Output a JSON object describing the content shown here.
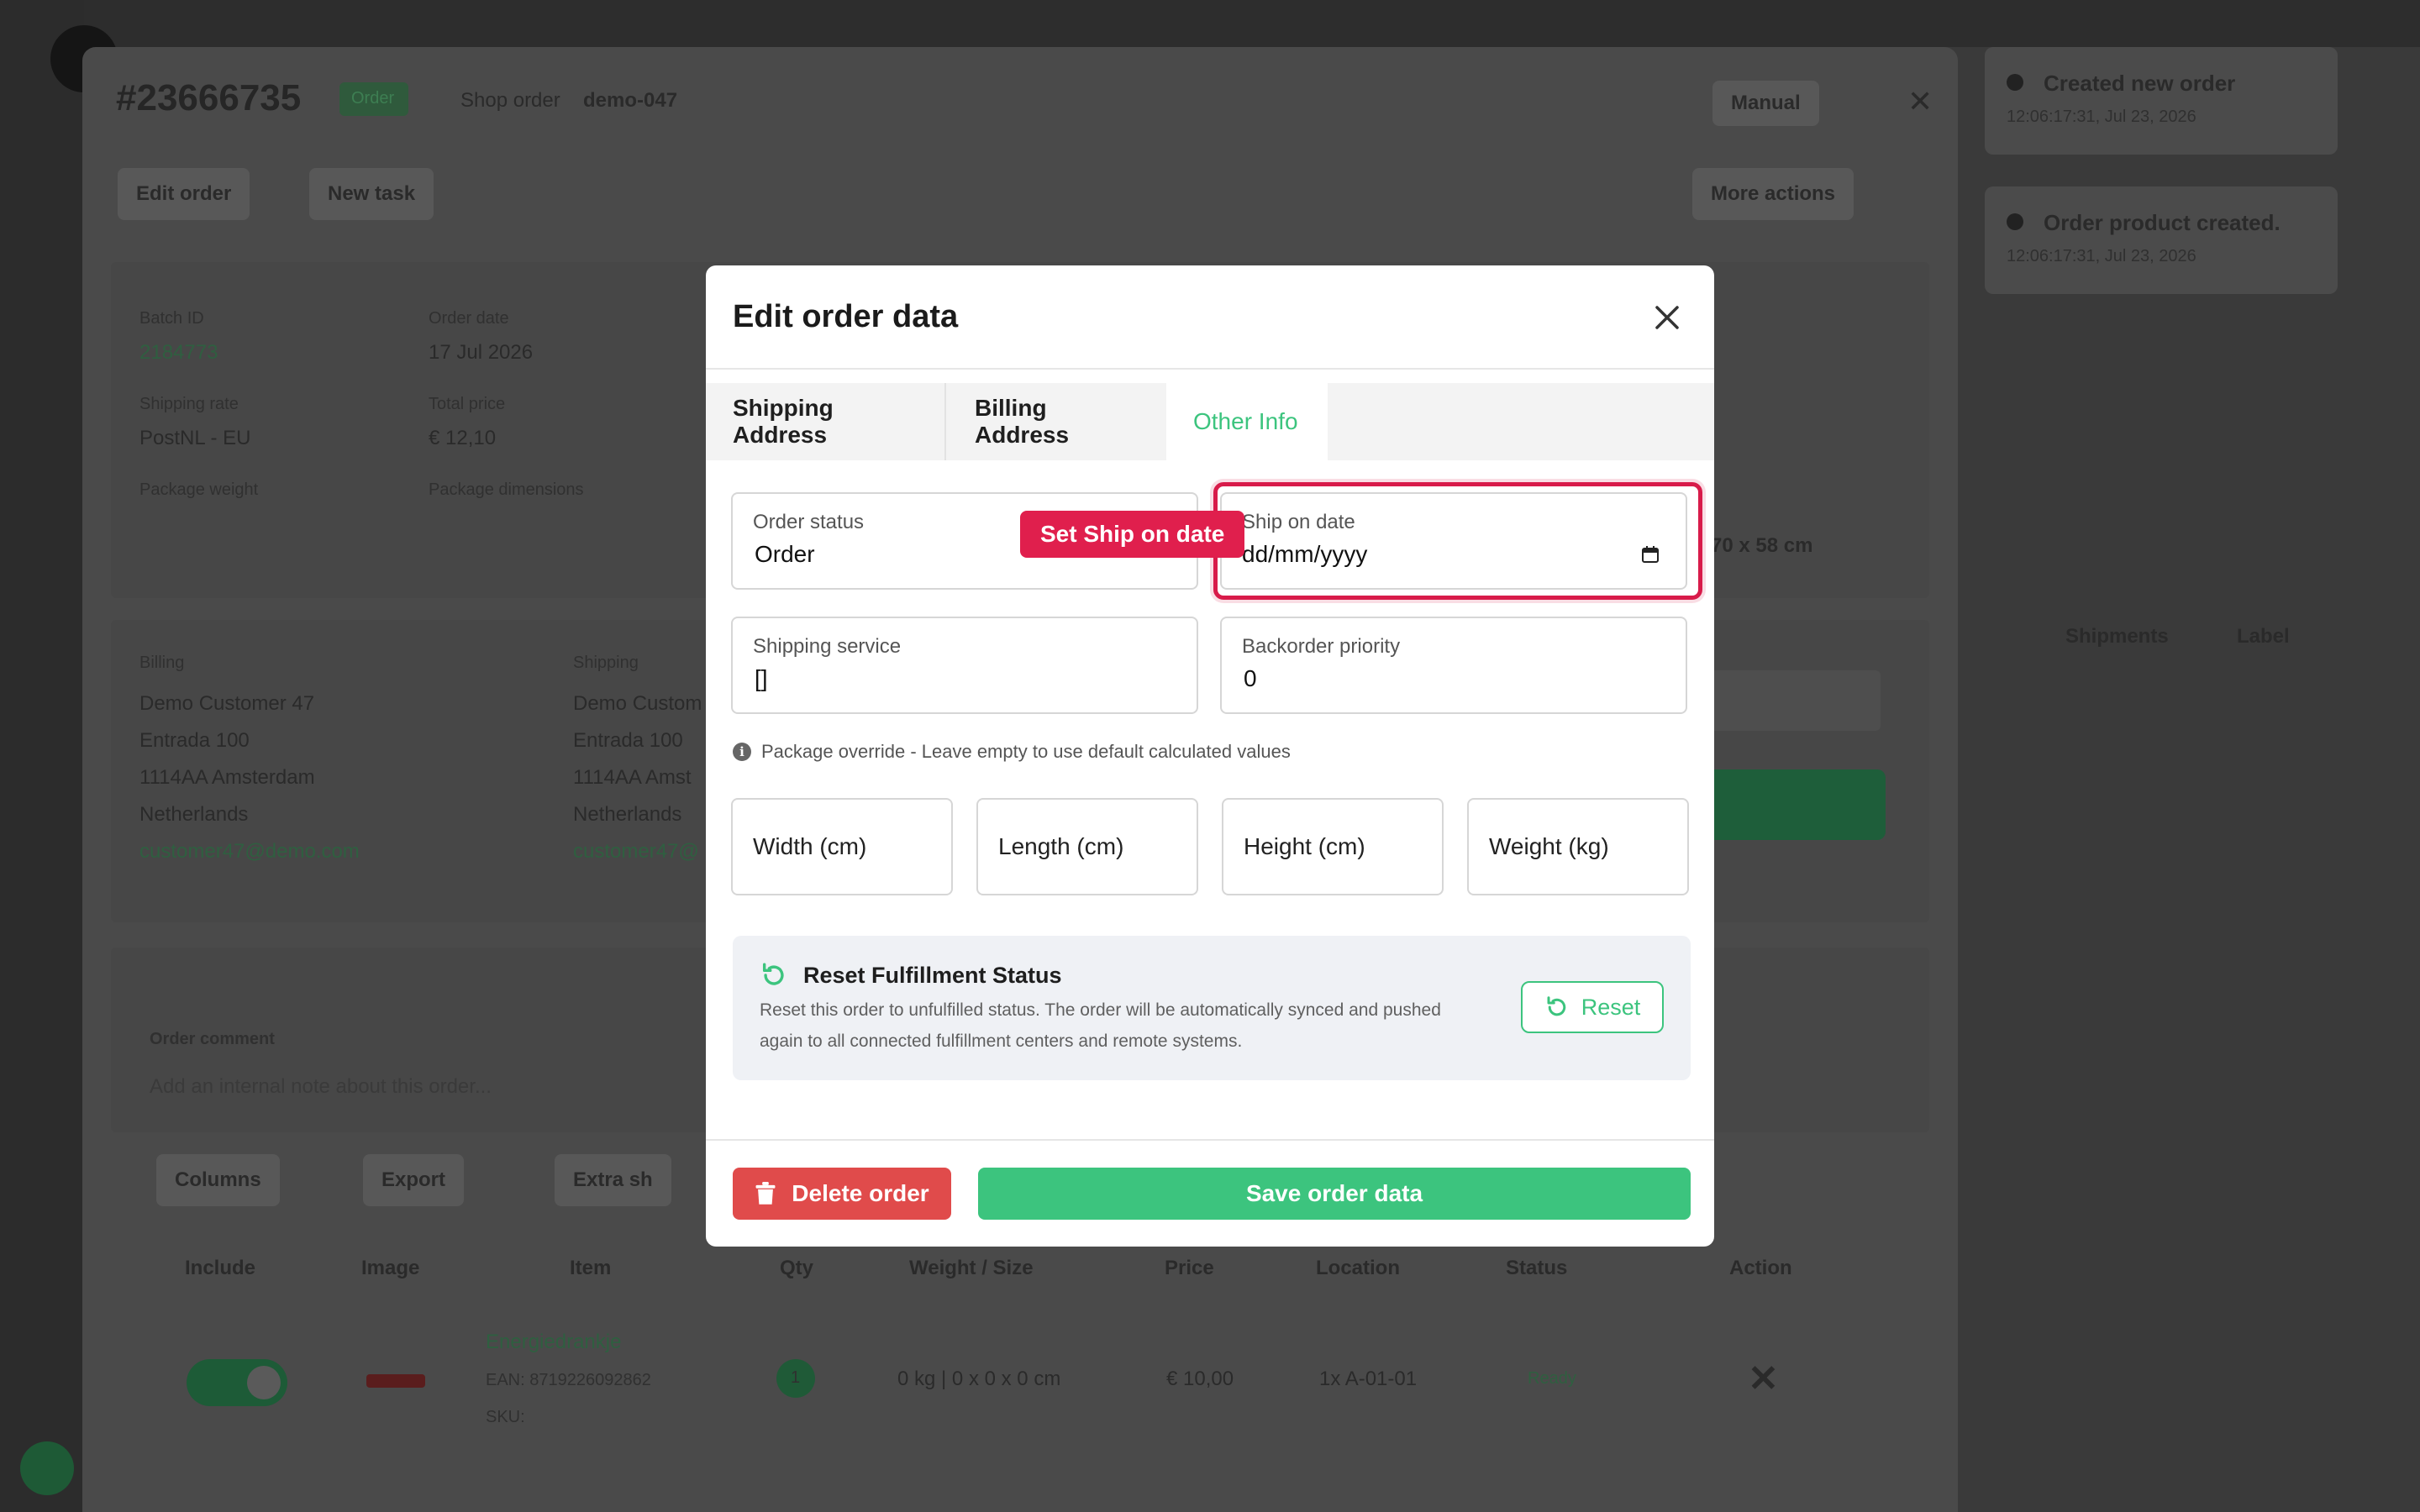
{
  "background": {
    "order_number": "#23666735",
    "order_badge": "Order",
    "shop_order_label": "Shop order",
    "shop_order_value": "demo-047",
    "manual_label": "Manual",
    "edit_order_label": "Edit order",
    "new_task_label": "New task",
    "more_actions_label": "More actions",
    "batch_id_label": "Batch ID",
    "batch_id_value": "2184773",
    "order_date_label": "Order date",
    "order_date_value": "17 Jul 2026",
    "shipping_rate_label": "Shipping rate",
    "shipping_rate_value": "PostNL - EU",
    "total_price_label": "Total price",
    "total_price_value": "€ 12,10",
    "package_weight_label": "Package weight",
    "package_dimensions_label": "Package dimensions",
    "dimensions_value": "70 x 58 cm",
    "billing_label": "Billing",
    "shipping_label": "Shipping",
    "billing_lines": [
      "Demo Customer 47",
      "Entrada 100",
      "1114AA Amsterdam",
      "Netherlands",
      "customer47@demo.com"
    ],
    "shipping_lines": [
      "Demo Custom",
      "Entrada 100",
      "1114AA Amst",
      "Netherlands",
      "customer47@"
    ],
    "order_comment_label": "Order comment",
    "order_comment_placeholder": "Add an internal note about this order...",
    "columns_label": "Columns",
    "export_label": "Export",
    "extra_label": "Extra sh",
    "table_headers": [
      "Include",
      "Image",
      "Item",
      "Qty",
      "Weight / Size",
      "Price",
      "Location",
      "Status",
      "Action"
    ],
    "row": {
      "item_name": "Energiedrankje",
      "item_ean": "EAN: 8719226092862",
      "item_sku": "SKU:",
      "qty": "1",
      "weight_size": "0 kg | 0 x 0 x 0 cm",
      "price": "€ 10,00",
      "location": "1x A-01-01",
      "status": "Ready"
    },
    "right_headers": [
      "Shipments",
      "Label"
    ],
    "toasts": [
      {
        "title": "Created new order",
        "time": "12:06:17:31, Jul 23, 2026"
      },
      {
        "title": "Order product created.",
        "time": "12:06:17:31, Jul 23, 2026"
      }
    ]
  },
  "modal": {
    "title": "Edit order data",
    "tabs": [
      {
        "label": "Shipping Address"
      },
      {
        "label": "Billing Address"
      },
      {
        "label": "Other Info"
      }
    ],
    "active_tab": "Other Info",
    "fields": {
      "order_status": {
        "label": "Order status",
        "value": "Order"
      },
      "ship_on_date": {
        "label": "Ship on date",
        "placeholder": "dd/mm/yyyy"
      },
      "shipping_service": {
        "label": "Shipping service",
        "value": "[]"
      },
      "backorder_priority": {
        "label": "Backorder priority",
        "value": "0"
      }
    },
    "package_override_note": "Package override - Leave empty to use default calculated values",
    "package_fields": {
      "width": "Width (cm)",
      "length": "Length (cm)",
      "height": "Height (cm)",
      "weight": "Weight (kg)"
    },
    "reset": {
      "title": "Reset Fulfillment Status",
      "description": "Reset this order to unfulfilled status. The order will be automatically synced and pushed again to all connected fulfillment centers and remote systems.",
      "button_label": "Reset"
    },
    "delete_label": "Delete order",
    "save_label": "Save order data"
  },
  "annotation": {
    "callout_label": "Set Ship on date",
    "highlight_color": "#d81b4a"
  },
  "colors": {
    "accent_green": "#3cc47e",
    "danger_red": "#e04b4b",
    "callout_red": "#e01f4d"
  }
}
